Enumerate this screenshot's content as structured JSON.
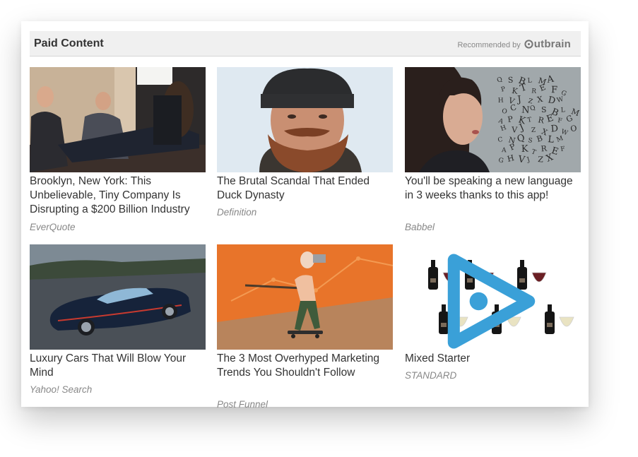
{
  "header": {
    "title": "Paid Content",
    "recommended_by": "Recommended by",
    "logo_text": "utbrain"
  },
  "colors": {
    "header_bg": "#f0f0f0",
    "title_text": "#333333",
    "source_text": "#888888",
    "adchoices_blue": "#3aa0d8"
  },
  "items": [
    {
      "title": "Brooklyn, New York: This Unbelievable, Tiny Company Is Disrupting a $200 Billion Industry",
      "source": "EverQuote"
    },
    {
      "title": "The Brutal Scandal That Ended Duck Dynasty",
      "source": "Definition"
    },
    {
      "title": "You'll be speaking a new language in 3 weeks thanks to this app!",
      "source": "Babbel"
    },
    {
      "title": "Luxury Cars That Will Blow Your Mind",
      "source": "Yahoo! Search"
    },
    {
      "title": "The 3 Most Overhyped Marketing Trends You Shouldn't Follow",
      "source": "Post Funnel"
    },
    {
      "title": "Mixed Starter",
      "source": "STANDARD"
    }
  ],
  "letters": [
    "Q",
    "S",
    "B",
    "L",
    "M",
    "A",
    "P",
    "K",
    "T",
    "R",
    "E",
    "F",
    "G",
    "H",
    "V",
    "J",
    "Z",
    "X",
    "D",
    "W",
    "O",
    "C",
    "N"
  ]
}
